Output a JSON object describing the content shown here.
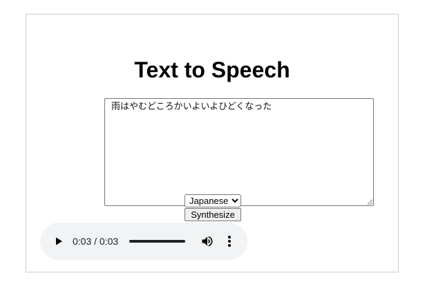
{
  "page": {
    "title": "Text to Speech"
  },
  "input": {
    "text": "雨はやむどころかいよいよひどくなった"
  },
  "language": {
    "selected": "Japanese",
    "options": [
      "Japanese"
    ]
  },
  "actions": {
    "synthesize_label": "Synthesize"
  },
  "audio": {
    "time_display": "0:03 / 0:03",
    "progress_fraction": 1.0,
    "icons": {
      "play": "play-icon",
      "volume": "volume-icon",
      "more": "more-options-icon"
    }
  },
  "colors": {
    "player_background": "#f1f3f4",
    "player_foreground": "#202124"
  }
}
